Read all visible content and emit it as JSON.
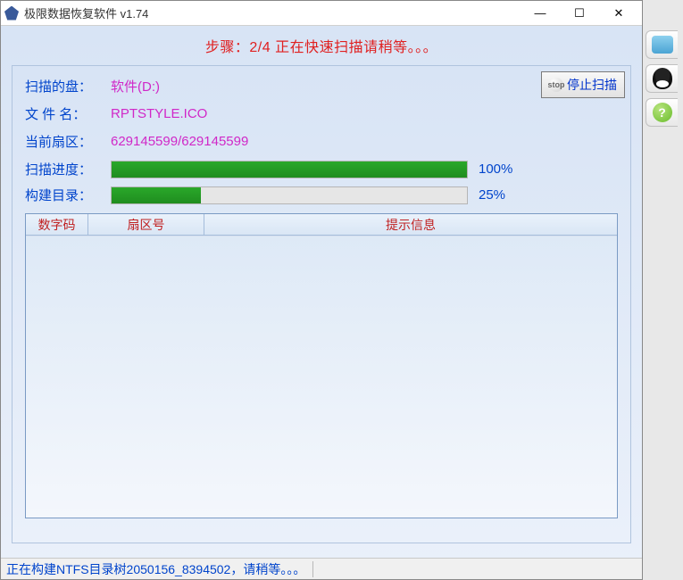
{
  "titlebar": {
    "title": "极限数据恢复软件 v1.74"
  },
  "step": "步骤：2/4 正在快速扫描请稍等。。。",
  "info": {
    "disk_label": "扫描的盘：",
    "disk_value": "软件(D:)",
    "file_label": "文 件 名：",
    "file_value": "RPTSTYLE.ICO",
    "sector_label": "当前扇区：",
    "sector_value": "629145599/629145599"
  },
  "progress_scan": {
    "label": "扫描进度：",
    "percent_text": "100%",
    "percent": 100
  },
  "progress_build": {
    "label": "构建目录：",
    "percent_text": "25%",
    "percent": 25
  },
  "table": {
    "headers": {
      "code": "数字码",
      "sector": "扇区号",
      "msg": "提示信息"
    }
  },
  "stop_button": "停止扫描",
  "statusbar": "正在构建NTFS目录树2050156_8394502，请稍等。。。",
  "side_help": "?"
}
